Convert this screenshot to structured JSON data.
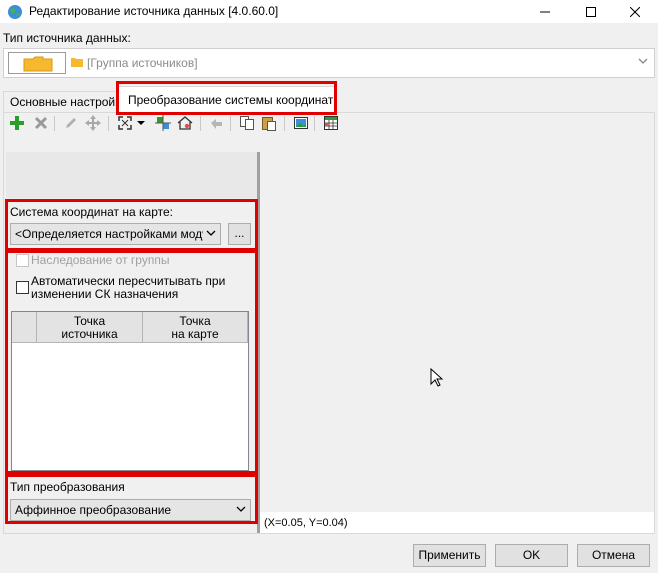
{
  "window": {
    "title": "Редактирование источника данных [4.0.60.0]"
  },
  "source_type": {
    "label": "Тип источника данных:",
    "value": "[Группа источников]"
  },
  "tabs": [
    {
      "label": "Основные настройки"
    },
    {
      "label": "Преобразование системы координат"
    }
  ],
  "toolbar": {
    "icons": [
      "add-icon",
      "delete-icon",
      "edit-icon",
      "move-icon",
      "zoom-extent-icon",
      "dropdown-arrow-icon",
      "pick-point-icon",
      "home-icon",
      "undo-icon",
      "copy-icon",
      "paste-icon",
      "image-icon",
      "table-icon"
    ]
  },
  "coord_system": {
    "label": "Система координат на карте:",
    "value": "<Определяется настройками модуля>",
    "browse_label": "..."
  },
  "inheritance": {
    "label": "Наследование от группы",
    "checked": false,
    "enabled": false
  },
  "auto_recalc": {
    "label_line1": "Автоматически пересчитывать при",
    "label_line2": "изменении СК назначения",
    "checked": false
  },
  "points_table": {
    "columns": [
      {
        "line1": "Точка",
        "line2": "источника"
      },
      {
        "line1": "Точка",
        "line2": "на карте"
      }
    ],
    "rows": []
  },
  "transform_type": {
    "label": "Тип преобразования",
    "value": "Аффинное преобразование"
  },
  "status_bar": {
    "coordinates": "(X=0.05, Y=0.04)"
  },
  "buttons": {
    "apply": "Применить",
    "ok": "OK",
    "cancel": "Отмена"
  },
  "colors": {
    "highlight": "#e00000",
    "add_green": "#2a9d2a",
    "folder_yellow": "#f5b82e"
  }
}
